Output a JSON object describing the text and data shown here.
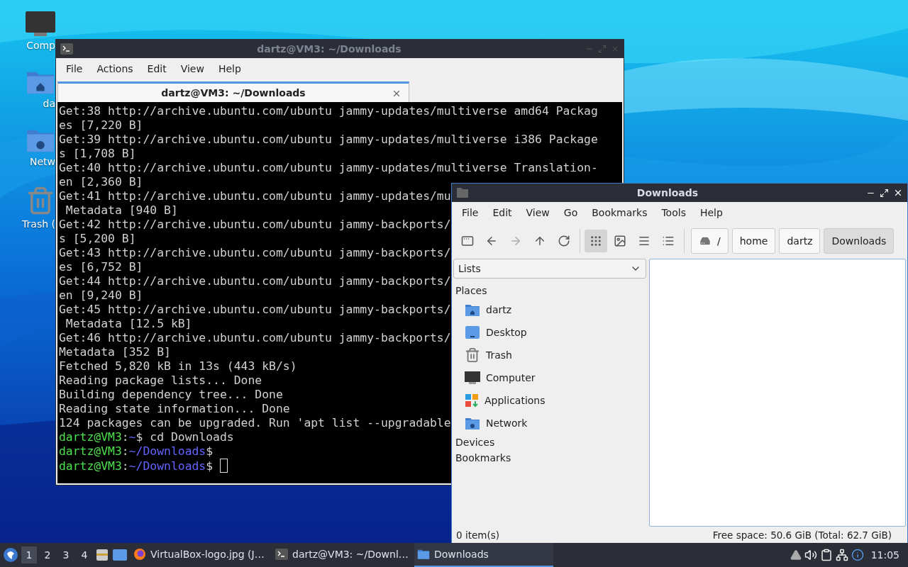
{
  "desktop": {
    "icons": [
      {
        "label": "Comp",
        "kind": "computer"
      },
      {
        "label": "da",
        "kind": "home"
      },
      {
        "label": "Netw",
        "kind": "network"
      },
      {
        "label": "Trash (",
        "kind": "trash"
      }
    ]
  },
  "terminal": {
    "title": "dartz@VM3: ~/Downloads",
    "menu": [
      "File",
      "Actions",
      "Edit",
      "View",
      "Help"
    ],
    "tabs": [
      {
        "label": "dartz@VM3: ~/Downloads",
        "selected": true
      }
    ],
    "lines": [
      {
        "kind": "output",
        "text": "Get:38 http://archive.ubuntu.com/ubuntu jammy-updates/multiverse amd64 Packag"
      },
      {
        "kind": "output",
        "text": "es [7,220 B]"
      },
      {
        "kind": "output",
        "text": "Get:39 http://archive.ubuntu.com/ubuntu jammy-updates/multiverse i386 Package"
      },
      {
        "kind": "output",
        "text": "s [1,708 B]"
      },
      {
        "kind": "output",
        "text": "Get:40 http://archive.ubuntu.com/ubuntu jammy-updates/multiverse Translation-"
      },
      {
        "kind": "output",
        "text": "en [2,360 B]"
      },
      {
        "kind": "output",
        "text": "Get:41 http://archive.ubuntu.com/ubuntu jammy-updates/mu"
      },
      {
        "kind": "output",
        "text": " Metadata [940 B]"
      },
      {
        "kind": "output",
        "text": "Get:42 http://archive.ubuntu.com/ubuntu jammy-backports/"
      },
      {
        "kind": "output",
        "text": "s [5,200 B]"
      },
      {
        "kind": "output",
        "text": "Get:43 http://archive.ubuntu.com/ubuntu jammy-backports/"
      },
      {
        "kind": "output",
        "text": "es [6,752 B]"
      },
      {
        "kind": "output",
        "text": "Get:44 http://archive.ubuntu.com/ubuntu jammy-backports/"
      },
      {
        "kind": "output",
        "text": "en [9,240 B]"
      },
      {
        "kind": "output",
        "text": "Get:45 http://archive.ubuntu.com/ubuntu jammy-backports/"
      },
      {
        "kind": "output",
        "text": " Metadata [12.5 kB]"
      },
      {
        "kind": "output",
        "text": "Get:46 http://archive.ubuntu.com/ubuntu jammy-backports/"
      },
      {
        "kind": "output",
        "text": "Metadata [352 B]"
      },
      {
        "kind": "output",
        "text": "Fetched 5,820 kB in 13s (443 kB/s)"
      },
      {
        "kind": "output",
        "text": "Reading package lists... Done"
      },
      {
        "kind": "output",
        "text": "Building dependency tree... Done"
      },
      {
        "kind": "output",
        "text": "Reading state information... Done"
      },
      {
        "kind": "output",
        "text": "124 packages can be upgraded. Run 'apt list --upgradable"
      },
      {
        "kind": "prompt",
        "user": "dartz@VM3",
        "sep": ":",
        "path": "~",
        "symbol": "$",
        "command": " cd Downloads",
        "cursor": false
      },
      {
        "kind": "prompt",
        "user": "dartz@VM3",
        "sep": ":",
        "path": "~/Downloads",
        "symbol": "$",
        "cursor": false
      },
      {
        "kind": "prompt",
        "user": "dartz@VM3",
        "sep": ":",
        "path": "~/Downloads",
        "symbol": "$",
        "cursor": true
      }
    ]
  },
  "file_manager": {
    "title": "Downloads",
    "menu": [
      "File",
      "Edit",
      "View",
      "Go",
      "Bookmarks",
      "Tools",
      "Help"
    ],
    "navigation": [
      {
        "kind": "new-tab",
        "disabled": false
      },
      {
        "kind": "back",
        "disabled": false
      },
      {
        "kind": "forward",
        "disabled": true
      },
      {
        "kind": "up",
        "disabled": false
      },
      {
        "kind": "reload",
        "disabled": false
      }
    ],
    "views": [
      {
        "kind": "icons",
        "selected": true
      },
      {
        "kind": "thumbnails",
        "selected": false
      },
      {
        "kind": "compact",
        "selected": false
      },
      {
        "kind": "details",
        "selected": false
      }
    ],
    "path": [
      {
        "label": "/",
        "kind": "root",
        "selected": false
      },
      {
        "label": "home",
        "kind": "folder",
        "selected": false
      },
      {
        "label": "dartz",
        "kind": "folder",
        "selected": false
      },
      {
        "label": "Downloads",
        "kind": "folder",
        "selected": true
      }
    ],
    "side_pane": {
      "mode": "Lists",
      "sections": [
        {
          "title": "Places",
          "items": [
            {
              "label": "dartz",
              "kind": "home"
            },
            {
              "label": "Desktop",
              "kind": "desktop"
            },
            {
              "label": "Trash",
              "kind": "trash"
            },
            {
              "label": "Computer",
              "kind": "computer"
            },
            {
              "label": "Applications",
              "kind": "applications"
            },
            {
              "label": "Network",
              "kind": "network"
            }
          ]
        },
        {
          "title": "Devices"
        },
        {
          "title": "Bookmarks"
        }
      ]
    },
    "status_bar": {
      "items": "0 item(s)",
      "space": "Free space: 50.6 GiB (Total: 62.7 GiB)"
    }
  },
  "taskbar": {
    "workspaces": [
      {
        "label": "1",
        "selected": true
      },
      {
        "label": "2",
        "selected": false
      },
      {
        "label": "3",
        "selected": false
      },
      {
        "label": "4",
        "selected": false
      }
    ],
    "launchers": [
      {
        "kind": "files"
      },
      {
        "kind": "desktop"
      }
    ],
    "tasks": [
      {
        "label": "VirtualBox-logo.jpg (J…",
        "kind": "browser",
        "selected": false
      },
      {
        "label": "dartz@VM3: ~/Downl…",
        "kind": "terminal",
        "selected": false
      },
      {
        "label": "Downloads",
        "kind": "folder",
        "selected": true
      }
    ],
    "tray": [
      {
        "kind": "arrow"
      },
      {
        "kind": "volume"
      },
      {
        "kind": "clipboard"
      },
      {
        "kind": "network"
      },
      {
        "kind": "update"
      }
    ],
    "clock": "11:05"
  }
}
